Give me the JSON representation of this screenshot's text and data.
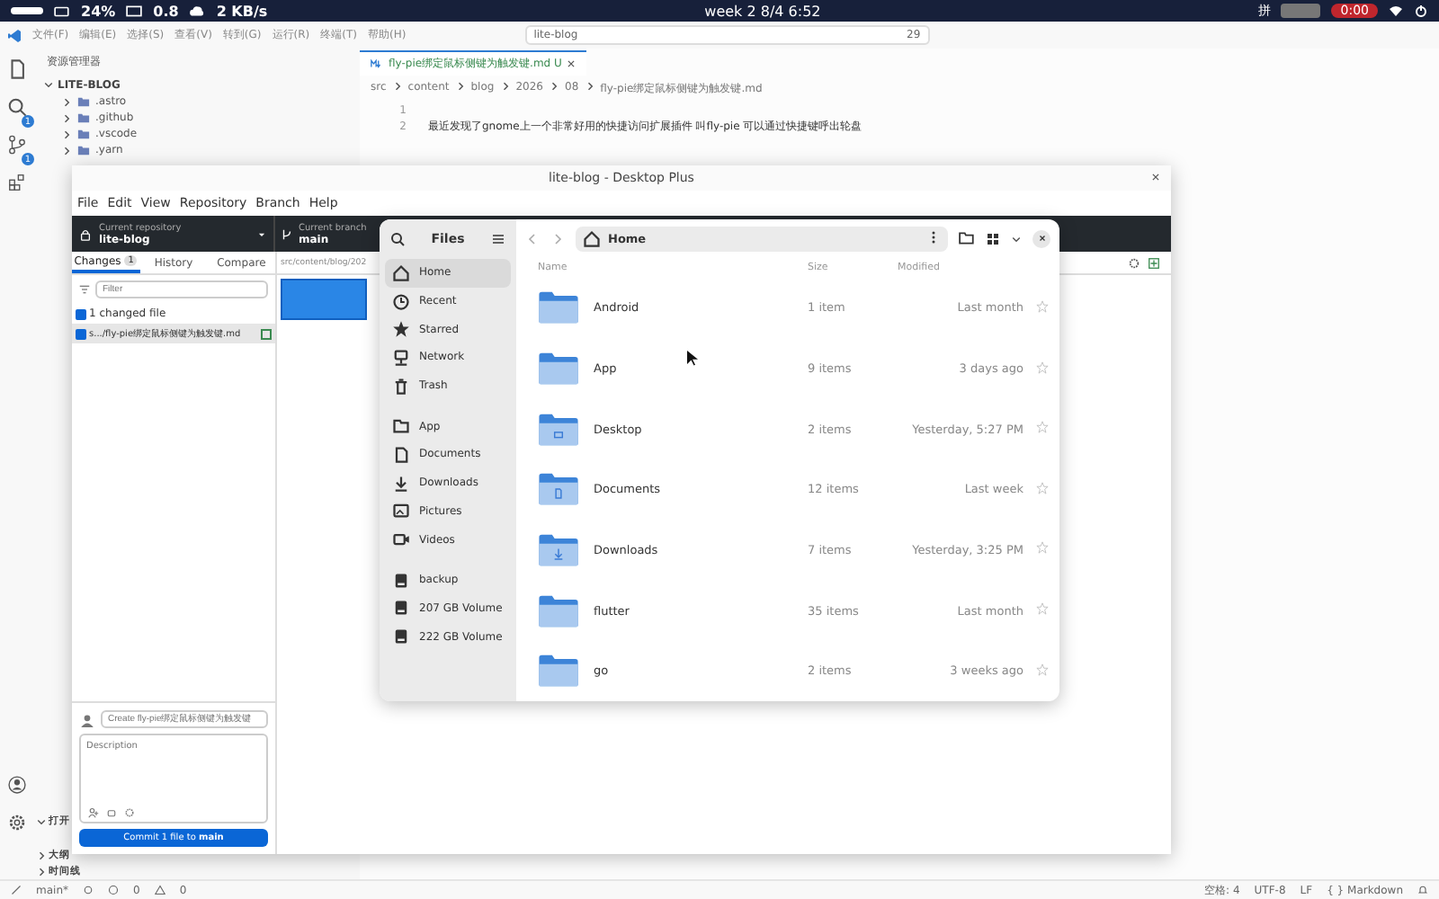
{
  "top_bar": {
    "battery": "24%",
    "load": "0.8",
    "network": "2 KB/s",
    "clock": "week 2  8/4  6:52",
    "input_method": "拼",
    "recording": "0:00"
  },
  "vscode": {
    "menu": [
      "文件(F)",
      "编辑(E)",
      "选择(S)",
      "查看(V)",
      "转到(G)",
      "运行(R)",
      "终端(T)",
      "帮助(H)"
    ],
    "search": {
      "value": "lite-blog"
    },
    "badge": "29",
    "activity_badges": [
      "1",
      "1"
    ],
    "explorer": {
      "title": "资源管理器",
      "root": "LITE-BLOG",
      "items": [
        ".astro",
        ".github",
        ".vscode",
        ".yarn"
      ],
      "sections": [
        {
          "label": "打开",
          "expanded": true
        },
        {
          "label": "大纲",
          "expanded": false
        },
        {
          "label": "时间线",
          "expanded": false
        }
      ]
    },
    "tab": {
      "label": "fly-pie绑定鼠标侧键为触发键.md",
      "status": "U"
    },
    "breadcrumb": [
      "src",
      "content",
      "blog",
      "2026",
      "08",
      "fly-pie绑定鼠标侧键为触发键.md"
    ],
    "lines": [
      {
        "number": "1"
      },
      {
        "number": "2",
        "text": "最近发现了gnome上一个非常好用的快捷访问扩展插件 叫fly-pie 可以通过快捷键呼出轮盘"
      }
    ],
    "status_bar": {
      "branch": "main*",
      "errors": "0",
      "warnings": "0",
      "items": [
        "空格: 4",
        "UTF-8",
        "LF",
        "{ } Markdown"
      ]
    }
  },
  "github_desktop": {
    "title": "lite-blog - Desktop Plus",
    "menu": [
      "File",
      "Edit",
      "View",
      "Repository",
      "Branch",
      "Help"
    ],
    "repository": {
      "label": "Current repository",
      "value": "lite-blog"
    },
    "branch": {
      "label": "Current branch",
      "value": "main"
    },
    "tabs": [
      {
        "label": "Changes",
        "count": "1",
        "selected": true
      },
      {
        "label": "History",
        "selected": false
      },
      {
        "label": "Compare",
        "selected": false
      }
    ],
    "filter": {
      "placeholder": "Filter"
    },
    "changed_summary": {
      "label": "1 changed file",
      "checked": true
    },
    "files": [
      {
        "name": "s.../fly-pie绑定鼠标侧键为触发键.md",
        "checked": true
      }
    ],
    "diff_path": "src/content/blog/202",
    "commit": {
      "summary_placeholder": "Create fly-pie绑定鼠标侧键为触发键",
      "description_placeholder": "Description",
      "button": "Commit 1 file to **main**"
    }
  },
  "files": {
    "title": "Files",
    "location": "Home",
    "sidebar_groups": [
      {
        "items": [
          {
            "label": "Home",
            "kind": "home",
            "selected": true
          },
          {
            "label": "Recent",
            "kind": "recent",
            "selected": false
          },
          {
            "label": "Starred",
            "kind": "starred",
            "selected": false
          },
          {
            "label": "Network",
            "kind": "network",
            "selected": false
          },
          {
            "label": "Trash",
            "kind": "trash",
            "selected": false
          }
        ]
      },
      {
        "items": [
          {
            "label": "App",
            "kind": "folder",
            "selected": false
          },
          {
            "label": "Documents",
            "kind": "document",
            "selected": false
          },
          {
            "label": "Downloads",
            "kind": "download",
            "selected": false
          },
          {
            "label": "Pictures",
            "kind": "picture",
            "selected": false
          },
          {
            "label": "Videos",
            "kind": "video",
            "selected": false
          }
        ]
      },
      {
        "items": [
          {
            "label": "backup",
            "kind": "drive",
            "selected": false
          },
          {
            "label": "207 GB Volume",
            "kind": "drive",
            "selected": false
          },
          {
            "label": "222 GB Volume",
            "kind": "drive",
            "selected": false
          }
        ]
      }
    ],
    "columns": [
      "Name",
      "Size",
      "Modified"
    ],
    "rows": [
      {
        "name": "Android",
        "size": "1 item",
        "modified": "Last month",
        "kind": "plain"
      },
      {
        "name": "App",
        "size": "9 items",
        "modified": "3 days ago",
        "kind": "plain"
      },
      {
        "name": "Desktop",
        "size": "2 items",
        "modified": "Yesterday, 5:27 PM",
        "kind": "desktop"
      },
      {
        "name": "Documents",
        "size": "12 items",
        "modified": "Last week",
        "kind": "documents"
      },
      {
        "name": "Downloads",
        "size": "7 items",
        "modified": "Yesterday, 3:25 PM",
        "kind": "downloads"
      },
      {
        "name": "flutter",
        "size": "35 items",
        "modified": "Last month",
        "kind": "plain"
      },
      {
        "name": "go",
        "size": "2 items",
        "modified": "3 weeks ago",
        "kind": "plain"
      }
    ]
  }
}
